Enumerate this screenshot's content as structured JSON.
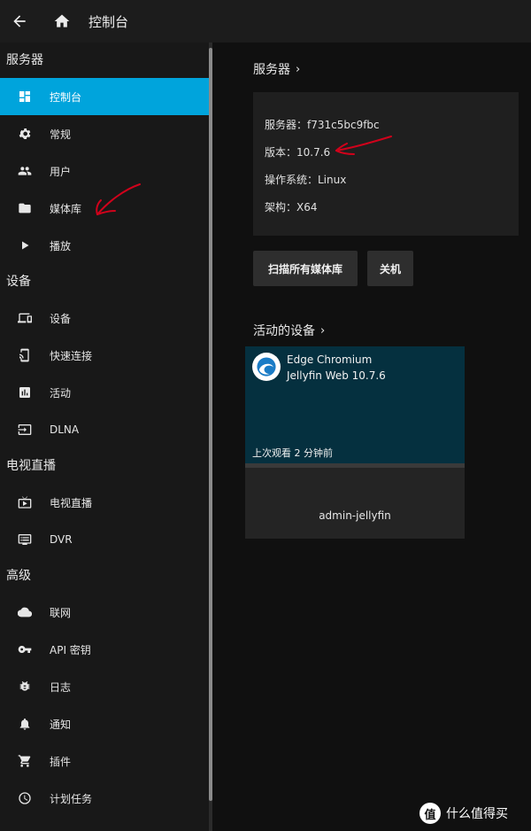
{
  "header": {
    "title": "控制台",
    "back_icon": "arrow-left-icon",
    "home_icon": "home-icon"
  },
  "sidebar": {
    "sections": [
      {
        "title": "服务器",
        "items": [
          {
            "label": "控制台",
            "icon": "dashboard-icon",
            "active": true
          },
          {
            "label": "常规",
            "icon": "gear-icon"
          },
          {
            "label": "用户",
            "icon": "people-icon"
          },
          {
            "label": "媒体库",
            "icon": "folder-icon"
          },
          {
            "label": "播放",
            "icon": "play-icon"
          }
        ]
      },
      {
        "title": "设备",
        "items": [
          {
            "label": "设备",
            "icon": "devices-icon"
          },
          {
            "label": "快速连接",
            "icon": "cast-icon"
          },
          {
            "label": "活动",
            "icon": "chart-icon"
          },
          {
            "label": "DLNA",
            "icon": "input-icon"
          }
        ]
      },
      {
        "title": "电视直播",
        "items": [
          {
            "label": "电视直播",
            "icon": "live-tv-icon"
          },
          {
            "label": "DVR",
            "icon": "dvr-icon"
          }
        ]
      },
      {
        "title": "高级",
        "items": [
          {
            "label": "联网",
            "icon": "cloud-icon"
          },
          {
            "label": "API 密钥",
            "icon": "key-icon"
          },
          {
            "label": "日志",
            "icon": "bug-icon"
          },
          {
            "label": "通知",
            "icon": "bell-icon"
          },
          {
            "label": "插件",
            "icon": "cart-icon"
          },
          {
            "label": "计划任务",
            "icon": "clock-icon"
          }
        ]
      }
    ]
  },
  "main": {
    "server": {
      "title": "服务器",
      "chevron": "›",
      "rows": [
        "服务器：f731c5bc9fbc",
        "版本：10.7.6",
        "操作系统：Linux",
        "架构：X64"
      ],
      "scan_button": "扫描所有媒体库",
      "shutdown_button": "关机"
    },
    "devices": {
      "title": "活动的设备",
      "chevron": "›",
      "card": {
        "app_name": "Edge Chromium",
        "app_version": "Jellyfin Web 10.7.6",
        "last_seen": "上次观看 2 分钟前",
        "user": "admin-jellyfin"
      }
    }
  },
  "watermark": {
    "logo": "值",
    "text": "什么值得买"
  },
  "colors": {
    "accent": "#00a4dc",
    "annotation": "#d0021b",
    "header_bg": "#1c1c1c",
    "sidebar_bg": "#181818"
  }
}
